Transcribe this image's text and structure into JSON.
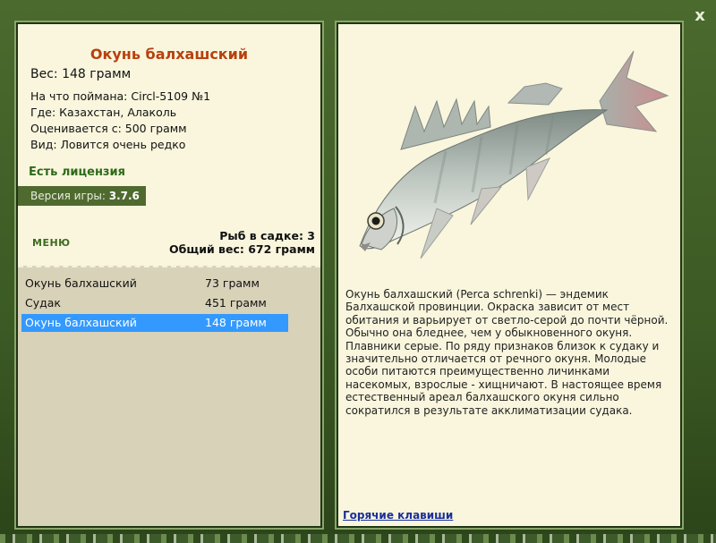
{
  "close_label": "x",
  "fish": {
    "title": "Окунь балхашский",
    "weight": "Вес: 148 грамм",
    "caught_on": "На что поймана: Circl-5109 №1",
    "where": "Где: Казахстан, Алаколь",
    "valued_from": "Оценивается с: 500 грамм",
    "kind": "Вид: Ловится очень редко"
  },
  "license": "Есть лицензия",
  "version": {
    "label": "Версия игры:",
    "value": "3.7.6"
  },
  "menu_label": "МЕНЮ",
  "keep": {
    "count": "Рыб в садке: 3",
    "total": "Общий вес: 672 грамм"
  },
  "catch_list": [
    {
      "name": "Окунь балхашский",
      "weight": "73 грамм",
      "selected": false
    },
    {
      "name": "Судак",
      "weight": "451 грамм",
      "selected": false
    },
    {
      "name": "Окунь балхашский",
      "weight": "148 грамм",
      "selected": true
    }
  ],
  "description": "Окунь балхашский (Perca schrenki) — эндемик Балхашской провинции. Окраска зависит от мест обитания и варьирует от светло-серой до почти чёрной. Обычно она бледнее, чем у обыкновенного окуня. Плавники серые. По ряду признаков близок к судаку и значительно отличается от речного окуня. Молодые особи питаются преимущественно личинками насекомых, взрослые - хищничают. В настоящее время естественный ареал балхашского окуня сильно сократился в результате акклиматизации судака.",
  "hotkeys_link": "Горячие клавиши",
  "colors": {
    "title": "#b8400f",
    "license": "#2e6a1a",
    "selection": "#3399ff",
    "link": "#1a2f9c"
  }
}
